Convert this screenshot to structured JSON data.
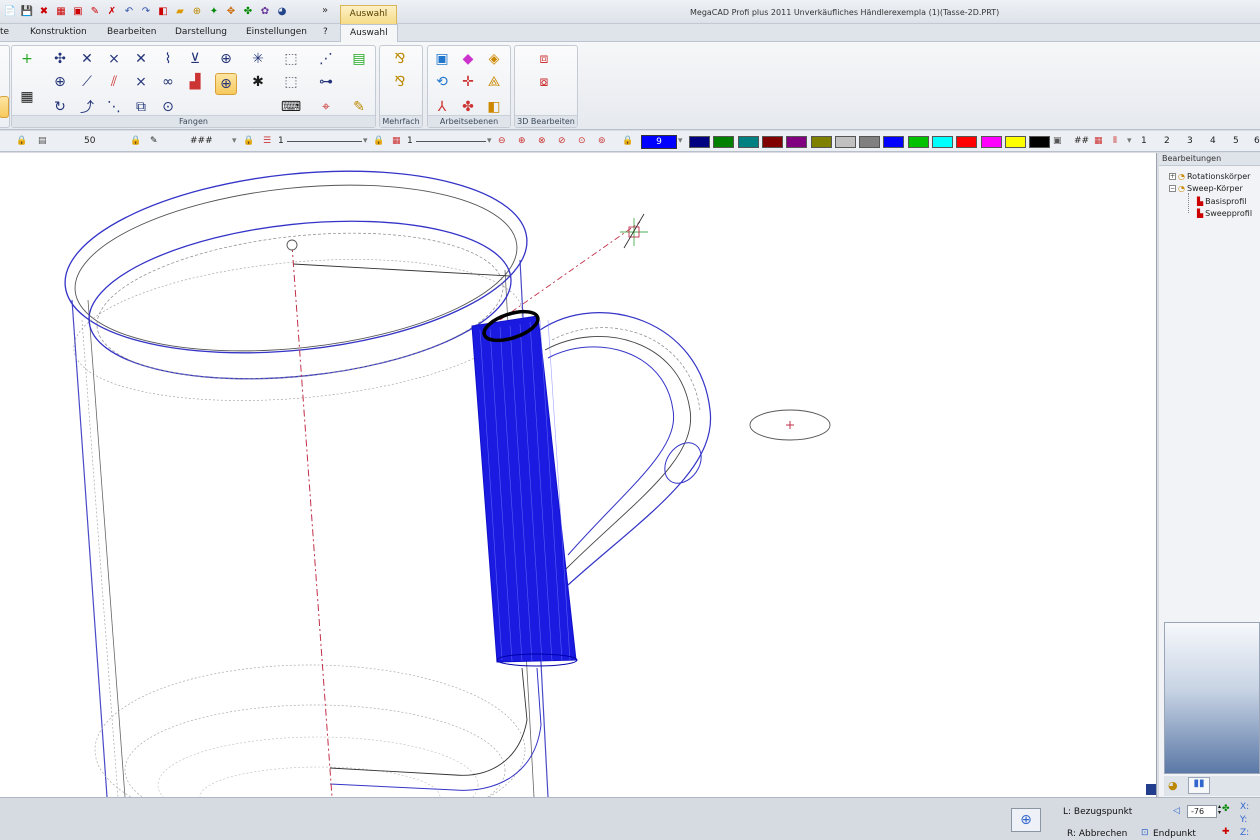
{
  "title_bar": {
    "app_title": "MegaCAD Profi plus 2011  Unverkäufliches Händlerexempla (1)(Tasse-2D.PRT)",
    "context_tab": "Auswahl",
    "overflow": "»"
  },
  "tabs": [
    "te",
    "Konstruktion",
    "Bearbeiten",
    "Darstellung",
    "Einstellungen",
    "?",
    "Auswahl"
  ],
  "ribbon_groups": {
    "fangen": "Fangen",
    "mehrfach": "Mehrfach",
    "arbeitsebenen": "Arbeitsebenen",
    "bearbeiten_3d": "3D Bearbeiten"
  },
  "toolbar2": {
    "field_value": "50",
    "hatch": "###",
    "line_type": "1",
    "line_width": "1",
    "current_color": "9",
    "grid_symbol": "##",
    "layers": [
      "1",
      "2",
      "3",
      "4",
      "5",
      "6"
    ],
    "colors": [
      "#0000ff",
      "#000080",
      "#008000",
      "#008080",
      "#800000",
      "#800080",
      "#808000",
      "#c0c0c0",
      "#808080",
      "#0000ff",
      "#00c000",
      "#00ffff",
      "#ff0000",
      "#ff00ff",
      "#ffff00",
      "#000000"
    ]
  },
  "panel": {
    "title": "Bearbeitungen",
    "tree": [
      {
        "label": "Rotationskörper",
        "expander": "+"
      },
      {
        "label": "Sweep-Körper",
        "expander": "−"
      },
      {
        "label": "Basisprofil"
      },
      {
        "label": "Sweepprofil"
      }
    ]
  },
  "status": {
    "left_hint": "L: Bezugspunkt",
    "right_hint": "R: Abbrechen",
    "snap_mode": "Endpunkt",
    "angle_value": "-76",
    "x_label": "X:",
    "y_label": "Y:",
    "z_label": "Z:"
  },
  "accent_colors": {
    "model_outline": "#3434c8",
    "sweep_body": "#1a1ae0",
    "axis": "#c0304a"
  }
}
